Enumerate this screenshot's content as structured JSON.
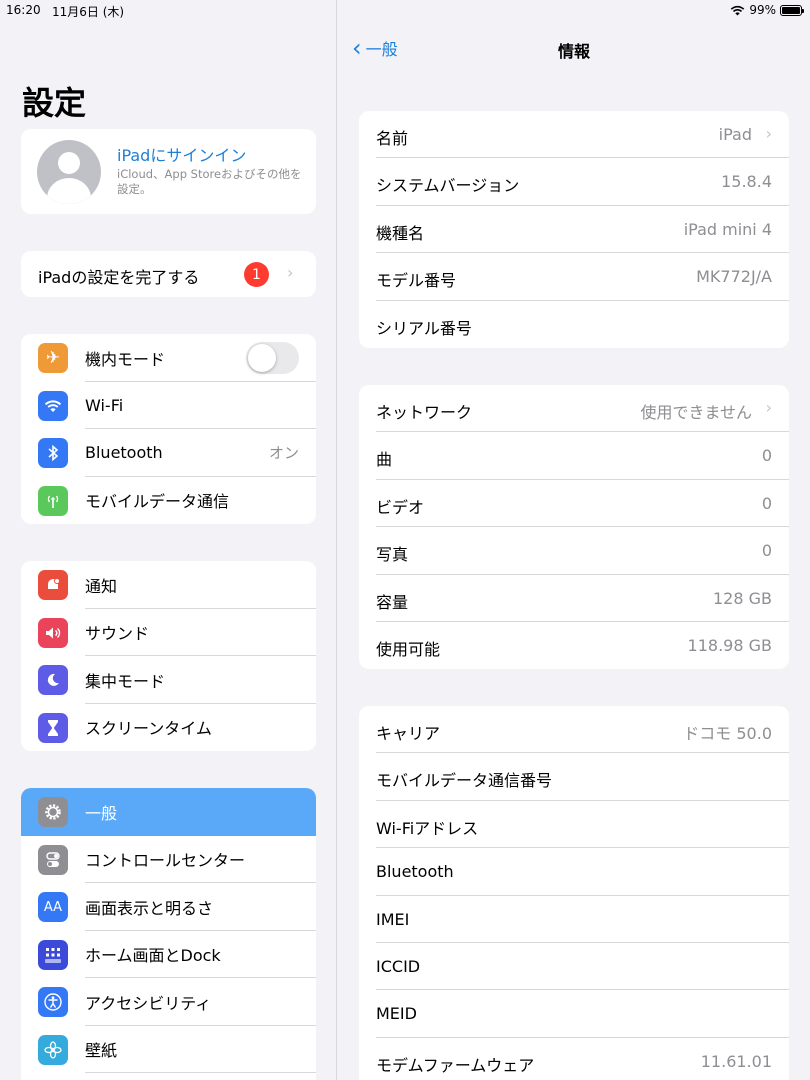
{
  "status": {
    "time": "16:20",
    "date": "11月6日 (木)",
    "battery": "99%",
    "battery_level": 0.99
  },
  "sidebar": {
    "title": "設定",
    "profile": {
      "title": "iPadにサインイン",
      "subtitle": "iCloud、App Storeおよびその他を設定。"
    },
    "setup": {
      "label": "iPadの設定を完了する",
      "badge": "1"
    },
    "group1": [
      {
        "label": "機内モード",
        "icon": "airplane-icon",
        "color": "#f09a37"
      },
      {
        "label": "Wi-Fi",
        "icon": "wifi-icon",
        "color": "#3478f6"
      },
      {
        "label": "Bluetooth",
        "value": "オン",
        "icon": "bluetooth-icon",
        "color": "#3478f6"
      },
      {
        "label": "モバイルデータ通信",
        "icon": "antenna-icon",
        "color": "#5ac85a"
      }
    ],
    "group2": [
      {
        "label": "通知",
        "icon": "notification-icon",
        "color": "#eb4d3d"
      },
      {
        "label": "サウンド",
        "icon": "speaker-icon",
        "color": "#eb445a"
      },
      {
        "label": "集中モード",
        "icon": "moon-icon",
        "color": "#5e5ce6"
      },
      {
        "label": "スクリーンタイム",
        "icon": "hourglass-icon",
        "color": "#5e5ce6"
      }
    ],
    "group3": [
      {
        "label": "一般",
        "icon": "gear-icon",
        "color": "#8e8e93"
      },
      {
        "label": "コントロールセンター",
        "icon": "control-center-icon",
        "color": "#8e8e93"
      },
      {
        "label": "画面表示と明るさ",
        "icon": "display-icon",
        "color": "#3478f6",
        "glyph": "AA"
      },
      {
        "label": "ホーム画面とDock",
        "icon": "home-screen-icon",
        "color": "#3b4ad8"
      },
      {
        "label": "アクセシビリティ",
        "icon": "accessibility-icon",
        "color": "#3478f6"
      },
      {
        "label": "壁紙",
        "icon": "wallpaper-icon",
        "color": "#35aadc"
      }
    ]
  },
  "detail": {
    "back_label": "一般",
    "title": "情報",
    "group1": [
      {
        "label": "名前",
        "value": "iPad",
        "chevron": true
      },
      {
        "label": "システムバージョン",
        "value": "15.8.4"
      },
      {
        "label": "機種名",
        "value": "iPad mini 4"
      },
      {
        "label": "モデル番号",
        "value": "MK772J/A"
      },
      {
        "label": "シリアル番号",
        "value": ""
      }
    ],
    "group2": [
      {
        "label": "ネットワーク",
        "value": "使用できません",
        "chevron": true
      },
      {
        "label": "曲",
        "value": "0"
      },
      {
        "label": "ビデオ",
        "value": "0"
      },
      {
        "label": "写真",
        "value": "0"
      },
      {
        "label": "容量",
        "value": "128 GB"
      },
      {
        "label": "使用可能",
        "value": "118.98 GB"
      }
    ],
    "group3": [
      {
        "label": "キャリア",
        "value": "ドコモ 50.0"
      },
      {
        "label": "モバイルデータ通信番号",
        "value": ""
      },
      {
        "label": "Wi-Fiアドレス",
        "value": ""
      },
      {
        "label": "Bluetooth",
        "value": ""
      },
      {
        "label": "IMEI",
        "value": ""
      },
      {
        "label": "ICCID",
        "value": ""
      },
      {
        "label": "MEID",
        "value": ""
      },
      {
        "label": "モデムファームウェア",
        "value": "11.61.01"
      }
    ]
  }
}
